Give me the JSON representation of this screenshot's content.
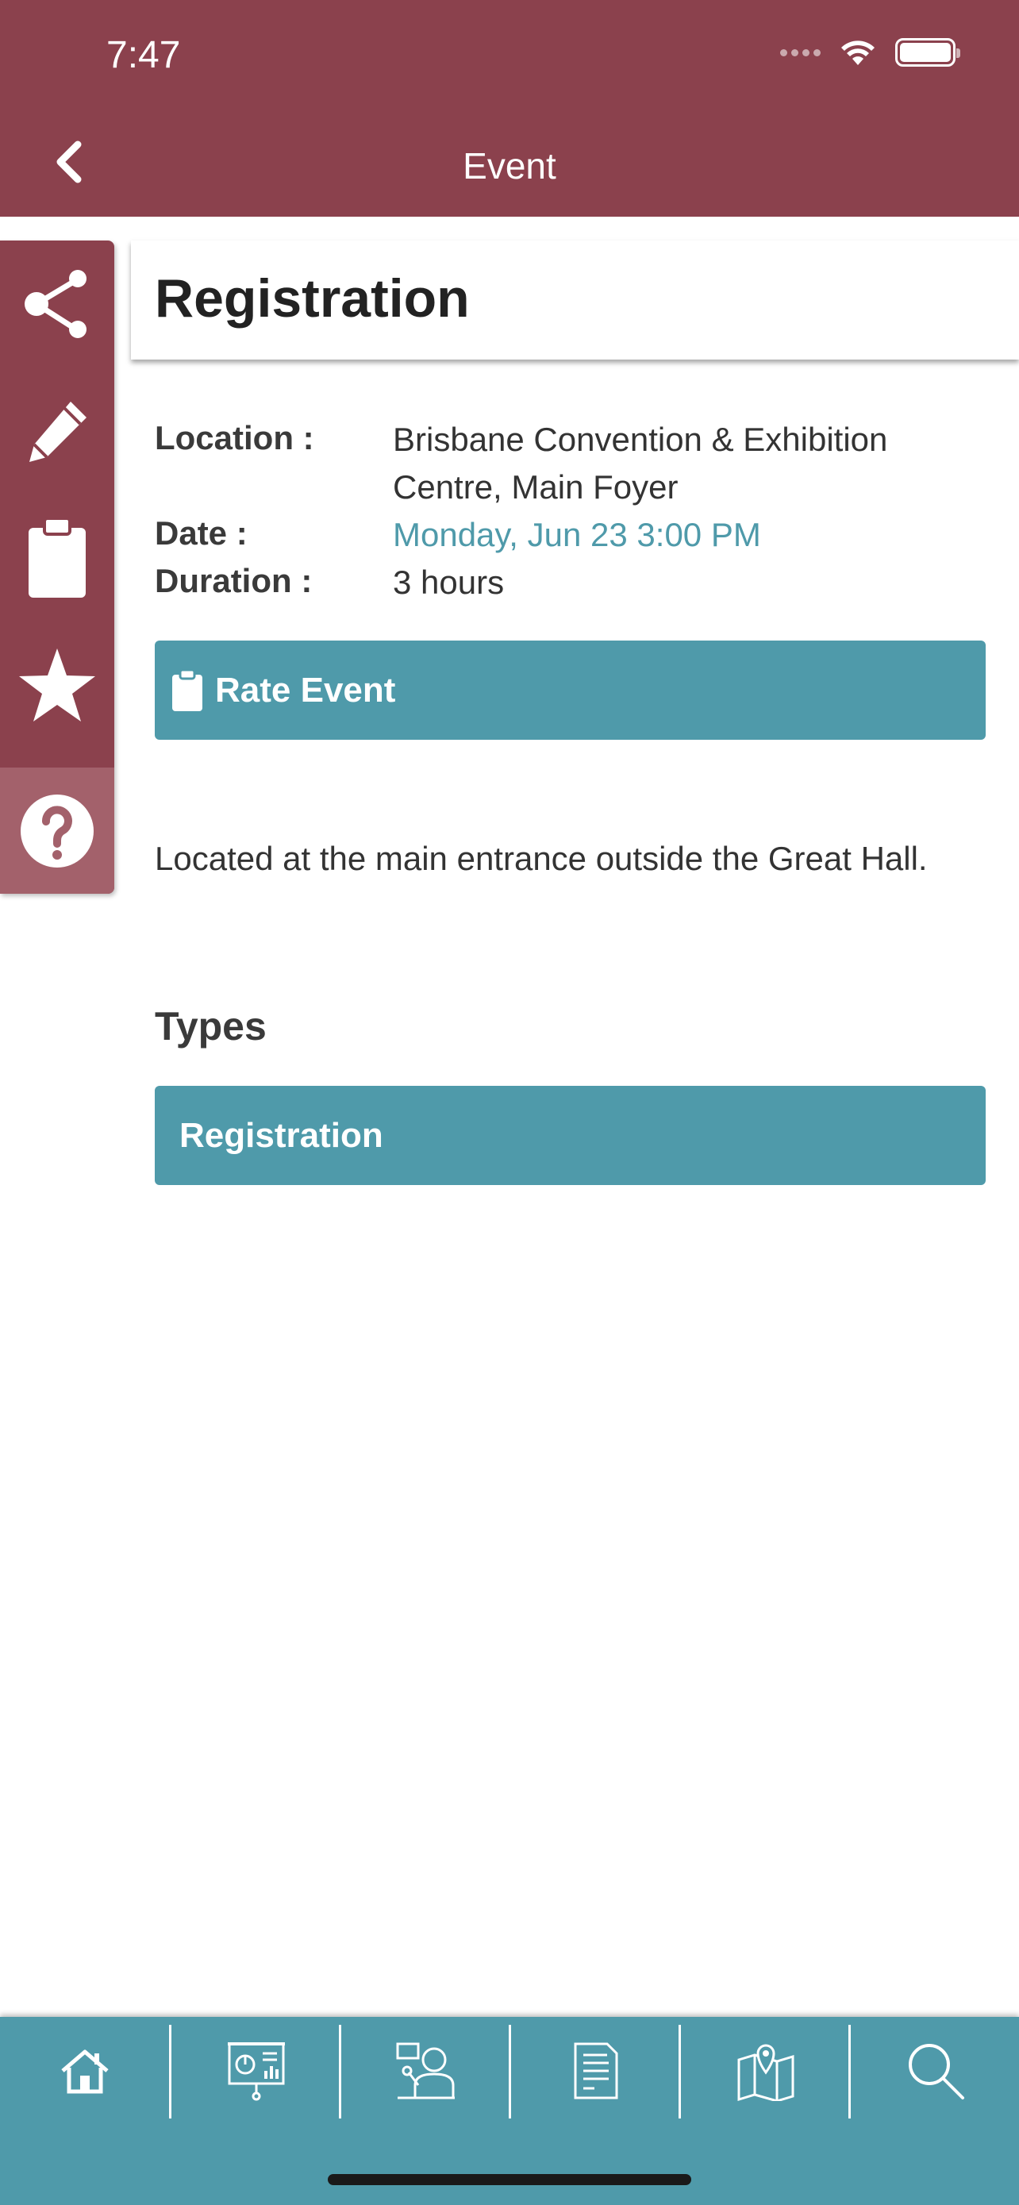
{
  "status_bar": {
    "time": "7:47"
  },
  "header": {
    "title": "Event",
    "back_icon": "chevron-left-icon"
  },
  "sidebar": {
    "items": [
      {
        "icon": "share-icon"
      },
      {
        "icon": "pencil-icon"
      },
      {
        "icon": "clipboard-icon"
      },
      {
        "icon": "star-icon"
      },
      {
        "icon": "help-icon"
      }
    ]
  },
  "event": {
    "title": "Registration",
    "location_label": "Location :",
    "location_line1": "Brisbane Convention & Exhibition",
    "location_line2": "Centre, Main Foyer",
    "date_label": "Date :",
    "date_value": "Monday, Jun 23 3:00 PM",
    "duration_label": "Duration :",
    "duration_value": "3 hours",
    "rate_button_label": "Rate Event",
    "description": "Located at the main entrance outside the Great Hall.",
    "types_heading": "Types",
    "types": [
      "Registration"
    ]
  },
  "tabbar": {
    "items": [
      {
        "icon": "home-icon"
      },
      {
        "icon": "presentation-icon"
      },
      {
        "icon": "speaker-icon"
      },
      {
        "icon": "document-icon"
      },
      {
        "icon": "map-icon"
      },
      {
        "icon": "search-icon"
      }
    ]
  },
  "colors": {
    "brand": "#8b414d",
    "accent": "#4f9aaa",
    "help_bg": "#a3616b"
  }
}
